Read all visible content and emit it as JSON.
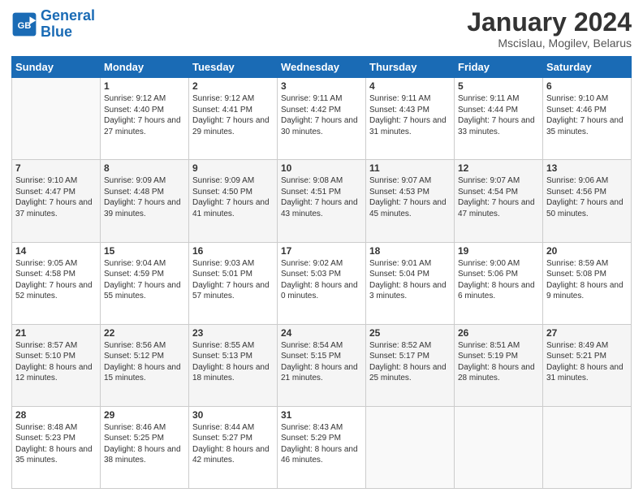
{
  "logo": {
    "line1": "General",
    "line2": "Blue"
  },
  "title": "January 2024",
  "subtitle": "Mscislau, Mogilev, Belarus",
  "weekdays": [
    "Sunday",
    "Monday",
    "Tuesday",
    "Wednesday",
    "Thursday",
    "Friday",
    "Saturday"
  ],
  "weeks": [
    [
      {
        "day": "",
        "sunrise": "",
        "sunset": "",
        "daylight": ""
      },
      {
        "day": "1",
        "sunrise": "9:12 AM",
        "sunset": "4:40 PM",
        "daylight": "7 hours and 27 minutes."
      },
      {
        "day": "2",
        "sunrise": "9:12 AM",
        "sunset": "4:41 PM",
        "daylight": "7 hours and 29 minutes."
      },
      {
        "day": "3",
        "sunrise": "9:11 AM",
        "sunset": "4:42 PM",
        "daylight": "7 hours and 30 minutes."
      },
      {
        "day": "4",
        "sunrise": "9:11 AM",
        "sunset": "4:43 PM",
        "daylight": "7 hours and 31 minutes."
      },
      {
        "day": "5",
        "sunrise": "9:11 AM",
        "sunset": "4:44 PM",
        "daylight": "7 hours and 33 minutes."
      },
      {
        "day": "6",
        "sunrise": "9:10 AM",
        "sunset": "4:46 PM",
        "daylight": "7 hours and 35 minutes."
      }
    ],
    [
      {
        "day": "7",
        "sunrise": "9:10 AM",
        "sunset": "4:47 PM",
        "daylight": "7 hours and 37 minutes."
      },
      {
        "day": "8",
        "sunrise": "9:09 AM",
        "sunset": "4:48 PM",
        "daylight": "7 hours and 39 minutes."
      },
      {
        "day": "9",
        "sunrise": "9:09 AM",
        "sunset": "4:50 PM",
        "daylight": "7 hours and 41 minutes."
      },
      {
        "day": "10",
        "sunrise": "9:08 AM",
        "sunset": "4:51 PM",
        "daylight": "7 hours and 43 minutes."
      },
      {
        "day": "11",
        "sunrise": "9:07 AM",
        "sunset": "4:53 PM",
        "daylight": "7 hours and 45 minutes."
      },
      {
        "day": "12",
        "sunrise": "9:07 AM",
        "sunset": "4:54 PM",
        "daylight": "7 hours and 47 minutes."
      },
      {
        "day": "13",
        "sunrise": "9:06 AM",
        "sunset": "4:56 PM",
        "daylight": "7 hours and 50 minutes."
      }
    ],
    [
      {
        "day": "14",
        "sunrise": "9:05 AM",
        "sunset": "4:58 PM",
        "daylight": "7 hours and 52 minutes."
      },
      {
        "day": "15",
        "sunrise": "9:04 AM",
        "sunset": "4:59 PM",
        "daylight": "7 hours and 55 minutes."
      },
      {
        "day": "16",
        "sunrise": "9:03 AM",
        "sunset": "5:01 PM",
        "daylight": "7 hours and 57 minutes."
      },
      {
        "day": "17",
        "sunrise": "9:02 AM",
        "sunset": "5:03 PM",
        "daylight": "8 hours and 0 minutes."
      },
      {
        "day": "18",
        "sunrise": "9:01 AM",
        "sunset": "5:04 PM",
        "daylight": "8 hours and 3 minutes."
      },
      {
        "day": "19",
        "sunrise": "9:00 AM",
        "sunset": "5:06 PM",
        "daylight": "8 hours and 6 minutes."
      },
      {
        "day": "20",
        "sunrise": "8:59 AM",
        "sunset": "5:08 PM",
        "daylight": "8 hours and 9 minutes."
      }
    ],
    [
      {
        "day": "21",
        "sunrise": "8:57 AM",
        "sunset": "5:10 PM",
        "daylight": "8 hours and 12 minutes."
      },
      {
        "day": "22",
        "sunrise": "8:56 AM",
        "sunset": "5:12 PM",
        "daylight": "8 hours and 15 minutes."
      },
      {
        "day": "23",
        "sunrise": "8:55 AM",
        "sunset": "5:13 PM",
        "daylight": "8 hours and 18 minutes."
      },
      {
        "day": "24",
        "sunrise": "8:54 AM",
        "sunset": "5:15 PM",
        "daylight": "8 hours and 21 minutes."
      },
      {
        "day": "25",
        "sunrise": "8:52 AM",
        "sunset": "5:17 PM",
        "daylight": "8 hours and 25 minutes."
      },
      {
        "day": "26",
        "sunrise": "8:51 AM",
        "sunset": "5:19 PM",
        "daylight": "8 hours and 28 minutes."
      },
      {
        "day": "27",
        "sunrise": "8:49 AM",
        "sunset": "5:21 PM",
        "daylight": "8 hours and 31 minutes."
      }
    ],
    [
      {
        "day": "28",
        "sunrise": "8:48 AM",
        "sunset": "5:23 PM",
        "daylight": "8 hours and 35 minutes."
      },
      {
        "day": "29",
        "sunrise": "8:46 AM",
        "sunset": "5:25 PM",
        "daylight": "8 hours and 38 minutes."
      },
      {
        "day": "30",
        "sunrise": "8:44 AM",
        "sunset": "5:27 PM",
        "daylight": "8 hours and 42 minutes."
      },
      {
        "day": "31",
        "sunrise": "8:43 AM",
        "sunset": "5:29 PM",
        "daylight": "8 hours and 46 minutes."
      },
      {
        "day": "",
        "sunrise": "",
        "sunset": "",
        "daylight": ""
      },
      {
        "day": "",
        "sunrise": "",
        "sunset": "",
        "daylight": ""
      },
      {
        "day": "",
        "sunrise": "",
        "sunset": "",
        "daylight": ""
      }
    ]
  ],
  "labels": {
    "sunrise_prefix": "Sunrise: ",
    "sunset_prefix": "Sunset: ",
    "daylight_prefix": "Daylight: "
  }
}
